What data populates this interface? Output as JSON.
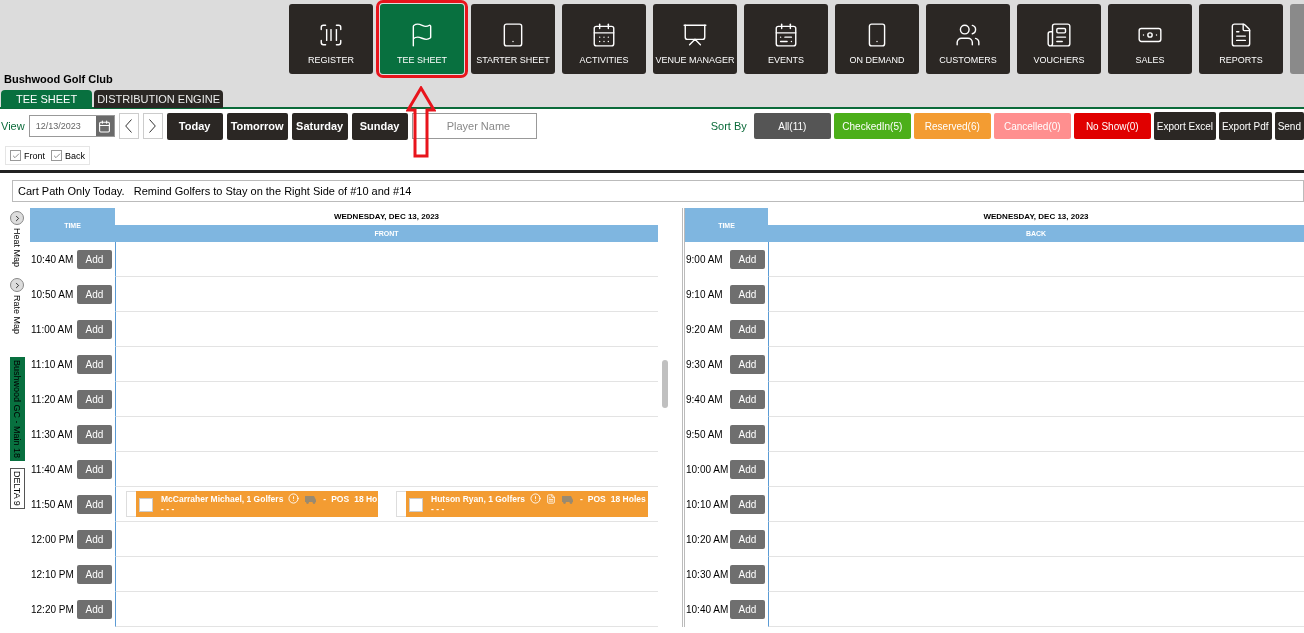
{
  "nav": [
    {
      "label": "REGISTER",
      "selected": false,
      "annotated": false
    },
    {
      "label": "TEE SHEET",
      "selected": true,
      "annotated": true
    },
    {
      "label": "STARTER SHEET",
      "selected": false,
      "annotated": false
    },
    {
      "label": "ACTIVITIES",
      "selected": false,
      "annotated": false
    },
    {
      "label": "VENUE MANAGER",
      "selected": false,
      "annotated": false
    },
    {
      "label": "EVENTS",
      "selected": false,
      "annotated": false
    },
    {
      "label": "ON DEMAND",
      "selected": false,
      "annotated": false
    },
    {
      "label": "CUSTOMERS",
      "selected": false,
      "annotated": false
    },
    {
      "label": "VOUCHERS",
      "selected": false,
      "annotated": false
    },
    {
      "label": "SALES",
      "selected": false,
      "annotated": false
    },
    {
      "label": "REPORTS",
      "selected": false,
      "annotated": false
    }
  ],
  "club_name": "Bushwood Golf Club",
  "tabs": [
    {
      "label": "TEE SHEET",
      "selected": true
    },
    {
      "label": "DISTRIBUTION ENGINE",
      "selected": false
    }
  ],
  "toolbar": {
    "view_label": "View",
    "date": "12/13/2023",
    "day_buttons": [
      "Today",
      "Tomorrow",
      "Saturday",
      "Sunday"
    ],
    "search": {
      "placeholder": "Player Name"
    },
    "sort_label": "Sort By",
    "filters": [
      {
        "label": "All(11)",
        "color": "#555555"
      },
      {
        "label": "CheckedIn(5)",
        "color": "#4caf1a"
      },
      {
        "label": "Reserved(6)",
        "color": "#f39c32"
      },
      {
        "label": "Cancelled(0)",
        "color": "#ff8f8f"
      },
      {
        "label": "No Show(0)",
        "color": "#e00000"
      }
    ],
    "exports": [
      "Export Excel",
      "Export Pdf",
      "Send"
    ]
  },
  "courses_filter": [
    {
      "label": "Front",
      "checked": true
    },
    {
      "label": "Back",
      "checked": true
    }
  ],
  "notice": "Cart Path Only Today.   Remind Golfers to Stay on the Right Side of #10 and #14",
  "side_panel": [
    {
      "kind": "toggle",
      "label": "Heat Map"
    },
    {
      "kind": "toggle",
      "label": "Rate Map"
    },
    {
      "kind": "course",
      "label": "Bushwood GC - Main 18",
      "selected": true
    },
    {
      "kind": "course",
      "label": "DELTA 9",
      "selected": false
    }
  ],
  "sheets": [
    {
      "time_header": "TIME",
      "date": "WEDNESDAY, DEC 13, 2023",
      "course": "FRONT",
      "rows": [
        {
          "time": "10:40 AM",
          "add": "Add"
        },
        {
          "time": "10:50 AM",
          "add": "Add"
        },
        {
          "time": "11:00 AM",
          "add": "Add"
        },
        {
          "time": "11:10 AM",
          "add": "Add"
        },
        {
          "time": "11:20 AM",
          "add": "Add"
        },
        {
          "time": "11:30 AM",
          "add": "Add"
        },
        {
          "time": "11:40 AM",
          "add": "Add"
        },
        {
          "time": "11:50 AM",
          "add": "Add",
          "bookings": [
            {
              "name": "McCarraher Michael, 1 Golfers",
              "checked": false,
              "has_note": false,
              "cart": "-",
              "payment": "POS",
              "holes": "18 Ho",
              "details": "- - -"
            },
            {
              "name": "Hutson Ryan, 1 Golfers",
              "checked": false,
              "has_note": true,
              "cart": "-",
              "payment": "POS",
              "holes": "18 Holes",
              "details": "- - -"
            }
          ]
        },
        {
          "time": "12:00 PM",
          "add": "Add"
        },
        {
          "time": "12:10 PM",
          "add": "Add"
        },
        {
          "time": "12:20 PM",
          "add": "Add"
        }
      ]
    },
    {
      "time_header": "TIME",
      "date": "WEDNESDAY, DEC 13, 2023",
      "course": "BACK",
      "rows": [
        {
          "time": "9:00 AM",
          "add": "Add"
        },
        {
          "time": "9:10 AM",
          "add": "Add"
        },
        {
          "time": "9:20 AM",
          "add": "Add"
        },
        {
          "time": "9:30 AM",
          "add": "Add"
        },
        {
          "time": "9:40 AM",
          "add": "Add"
        },
        {
          "time": "9:50 AM",
          "add": "Add"
        },
        {
          "time": "10:00 AM",
          "add": "Add"
        },
        {
          "time": "10:10 AM",
          "add": "Add"
        },
        {
          "time": "10:20 AM",
          "add": "Add"
        },
        {
          "time": "10:30 AM",
          "add": "Add"
        },
        {
          "time": "10:40 AM",
          "add": "Add"
        }
      ]
    }
  ]
}
